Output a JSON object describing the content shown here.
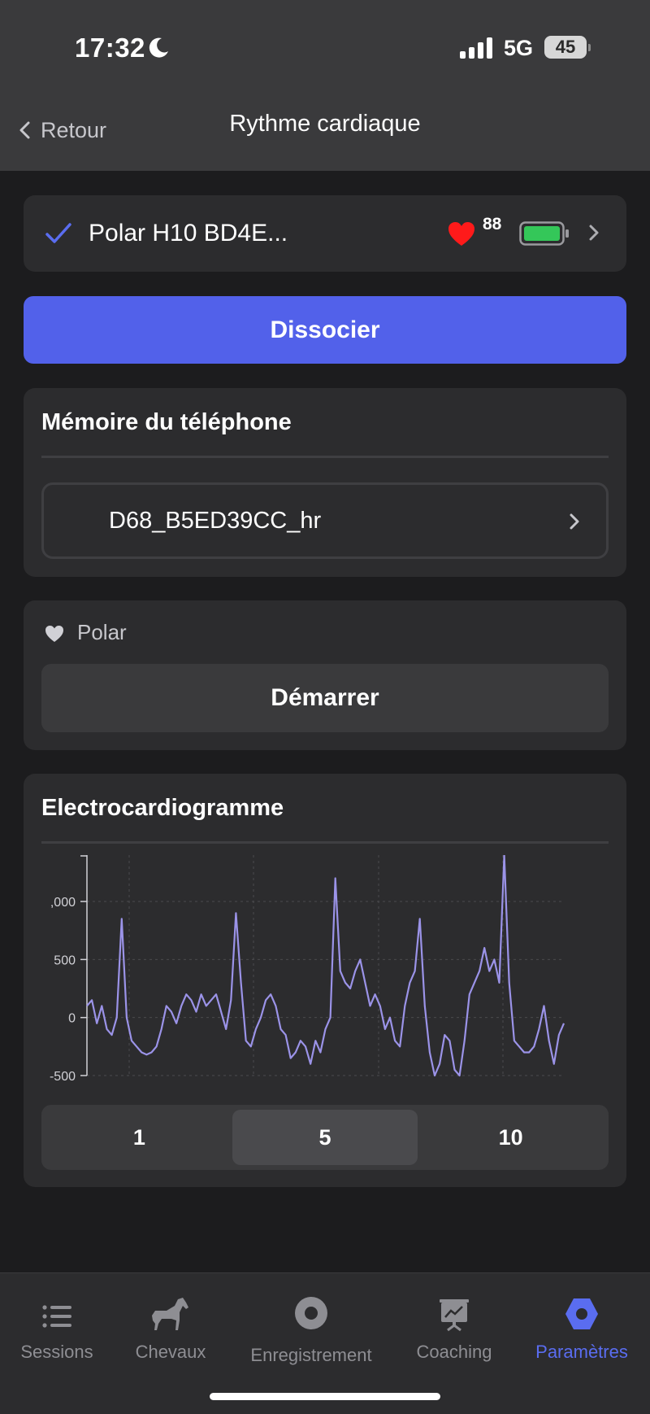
{
  "status_bar": {
    "time": "17:32",
    "network": "5G",
    "battery": "45"
  },
  "nav": {
    "back_label": "Retour",
    "title": "Rythme cardiaque"
  },
  "device": {
    "name": "Polar H10 BD4E...",
    "heart_rate": "88",
    "connected": true,
    "colors": {
      "check": "#5a6df0",
      "heart": "#ff1a1a",
      "battery": "#34c759"
    }
  },
  "dissociate_button": "Dissocier",
  "memory": {
    "title": "Mémoire du téléphone",
    "file": "D68_B5ED39CC_hr"
  },
  "polar": {
    "label": "Polar",
    "start_button": "Démarrer"
  },
  "ecg": {
    "title": "Electrocardiogramme",
    "selected_range": "5"
  },
  "chart_data": {
    "type": "line",
    "ylim": [
      -500,
      1400
    ],
    "y_ticks": [
      ",000",
      "500",
      "0",
      "-500"
    ],
    "grid": true,
    "series": [
      {
        "color": "#9b93e8",
        "values": [
          100,
          150,
          -50,
          100,
          -100,
          -150,
          0,
          850,
          0,
          -200,
          -250,
          -300,
          -320,
          -300,
          -250,
          -100,
          100,
          50,
          -50,
          100,
          200,
          150,
          50,
          200,
          100,
          150,
          200,
          50,
          -100,
          150,
          900,
          300,
          -200,
          -250,
          -100,
          0,
          150,
          200,
          100,
          -100,
          -150,
          -350,
          -300,
          -200,
          -250,
          -400,
          -200,
          -300,
          -100,
          0,
          1200,
          400,
          300,
          250,
          400,
          500,
          300,
          100,
          200,
          100,
          -100,
          0,
          -200,
          -250,
          100,
          300,
          400,
          850,
          100,
          -300,
          -500,
          -400,
          -150,
          -200,
          -450,
          -500,
          -200,
          200,
          300,
          400,
          600,
          400,
          500,
          300,
          1400,
          300,
          -200,
          -250,
          -300,
          -300,
          -250,
          -100,
          100,
          -200,
          -400,
          -150,
          -50
        ]
      }
    ]
  },
  "segments": [
    {
      "label": "1",
      "selected": false
    },
    {
      "label": "5",
      "selected": true
    },
    {
      "label": "10",
      "selected": false
    }
  ],
  "tabs": [
    {
      "label": "Sessions",
      "icon": "list-icon",
      "active": false
    },
    {
      "label": "Chevaux",
      "icon": "horse-icon",
      "active": false
    },
    {
      "label": "Enregistrement",
      "icon": "record-icon",
      "active": false
    },
    {
      "label": "Coaching",
      "icon": "presentation-icon",
      "active": false
    },
    {
      "label": "Paramètres",
      "icon": "settings-icon",
      "active": true
    }
  ]
}
